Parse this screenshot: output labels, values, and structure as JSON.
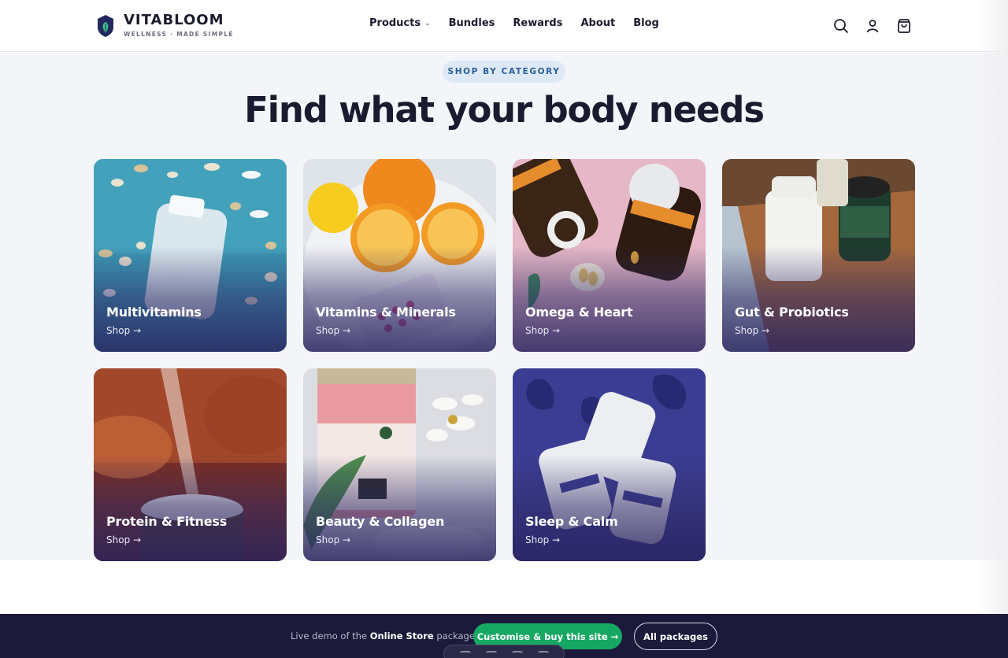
{
  "brand": {
    "name": "VITABLOOM",
    "tagline": "WELLNESS · MADE SIMPLE",
    "logo_icon": "leaf-shield-icon",
    "colors": {
      "logo_dark": "#23285e",
      "logo_leaf": "#3fbf84"
    }
  },
  "nav": {
    "items": [
      {
        "label": "Products",
        "has_dropdown": true
      },
      {
        "label": "Bundles"
      },
      {
        "label": "Rewards"
      },
      {
        "label": "About"
      },
      {
        "label": "Blog"
      }
    ],
    "icons": [
      "search-icon",
      "account-icon",
      "cart-icon"
    ]
  },
  "section": {
    "eyebrow": "SHOP BY CATEGORY",
    "heading": "Find what your body needs"
  },
  "categories": [
    {
      "title": "Multivitamins",
      "link": "Shop →",
      "image": "white pill bottle on blue background"
    },
    {
      "title": "Vitamins & Minerals",
      "link": "Shop →",
      "image": "oranges, lemon and vitamin blister pack"
    },
    {
      "title": "Omega & Heart",
      "link": "Shop →",
      "image": "fish oil jars on pink background"
    },
    {
      "title": "Gut & Probiotics",
      "link": "Shop →",
      "image": "supplement jars on wooden board"
    },
    {
      "title": "Protein & Fitness",
      "link": "Shop →",
      "image": "protein powder tub"
    },
    {
      "title": "Beauty & Collagen",
      "link": "Shop →",
      "image": "collagen canister with flowers"
    },
    {
      "title": "Sleep & Calm",
      "link": "Shop →",
      "image": "supplement bottles on deep blue background"
    }
  ],
  "demo_bar": {
    "text_prefix": "Live demo of the",
    "text_bold": "Online Store",
    "text_suffix": "package.",
    "primary_button": "Customise & buy this site →",
    "secondary_button": "All packages",
    "colors": {
      "background": "#1b1a3b",
      "primary": "#16a862"
    }
  },
  "theme": {
    "accent": "#2b5f96",
    "eyebrow_bg": "#dde9f7",
    "section_bg": "#f4f5f9",
    "text": "#1a1b2e"
  }
}
